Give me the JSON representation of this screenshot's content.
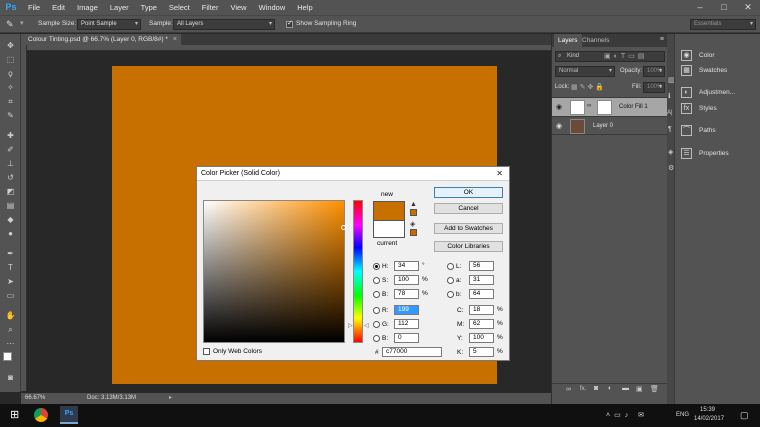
{
  "app": {
    "logo": "Ps",
    "menu": [
      "File",
      "Edit",
      "Image",
      "Layer",
      "Type",
      "Select",
      "Filter",
      "View",
      "Window",
      "Help"
    ],
    "window_controls": [
      "–",
      "□",
      "✕"
    ]
  },
  "options_bar": {
    "sample_size_label": "Sample Size:",
    "sample_size_value": "Point Sample",
    "sample_label": "Sample:",
    "sample_value": "All Layers",
    "show_ring_label": "Show Sampling Ring",
    "workspace_value": "Essentials"
  },
  "document": {
    "tab_title": "Colour Tinting.psd @ 66.7% (Layer 0, RGB/8#) *",
    "tab_close": "×",
    "canvas_color": "#c77000",
    "zoom": "66.67%",
    "doc_info": "Doc: 3.13M/3.13M"
  },
  "layers_panel": {
    "tabs": [
      "Layers",
      "Channels"
    ],
    "kind_label": "Kind",
    "blend_mode": "Normal",
    "opacity_label": "Opacity:",
    "opacity_value": "100%",
    "lock_label": "Lock:",
    "fill_label": "Fill:",
    "fill_value": "100%",
    "layers": [
      {
        "name": "Color Fill 1",
        "selected": true
      },
      {
        "name": "Layer 0",
        "selected": false
      }
    ],
    "footer_icons": [
      "link-icon",
      "fx-icon",
      "mask-icon",
      "adjustment-icon",
      "group-icon",
      "new-layer-icon",
      "trash-icon"
    ],
    "footer_fx": "fx."
  },
  "right_panels": {
    "group1": [
      "Color",
      "Swatches"
    ],
    "group2": [
      "Adjustmen...",
      "Styles"
    ],
    "group3": [
      "Paths"
    ],
    "group4": [
      "Properties"
    ]
  },
  "dialog": {
    "title": "Color Picker (Solid Color)",
    "close": "✕",
    "new_label": "new",
    "current_label": "current",
    "new_color": "#c77000",
    "current_color": "#ffffff",
    "buttons": {
      "ok": "OK",
      "cancel": "Cancel",
      "add_swatches": "Add to Swatches",
      "color_libraries": "Color Libraries"
    },
    "fields": {
      "H": {
        "label": "H:",
        "value": "34",
        "unit": "°"
      },
      "S": {
        "label": "S:",
        "value": "100",
        "unit": "%"
      },
      "B": {
        "label": "B:",
        "value": "78",
        "unit": "%"
      },
      "R": {
        "label": "R:",
        "value": "199",
        "unit": ""
      },
      "G": {
        "label": "G:",
        "value": "112",
        "unit": ""
      },
      "Bl": {
        "label": "B:",
        "value": "0",
        "unit": ""
      },
      "L": {
        "label": "L:",
        "value": "56",
        "unit": ""
      },
      "a": {
        "label": "a:",
        "value": "31",
        "unit": ""
      },
      "b": {
        "label": "b:",
        "value": "64",
        "unit": ""
      },
      "C": {
        "label": "C:",
        "value": "18",
        "unit": "%"
      },
      "M": {
        "label": "M:",
        "value": "62",
        "unit": "%"
      },
      "Y": {
        "label": "Y:",
        "value": "100",
        "unit": "%"
      },
      "K": {
        "label": "K:",
        "value": "5",
        "unit": "%"
      }
    },
    "hex_label": "#",
    "hex_value": "c77000",
    "web_colors_label": "Only Web Colors"
  },
  "taskbar": {
    "time": "15:39",
    "date": "14/02/2017",
    "lang": "ENG"
  }
}
